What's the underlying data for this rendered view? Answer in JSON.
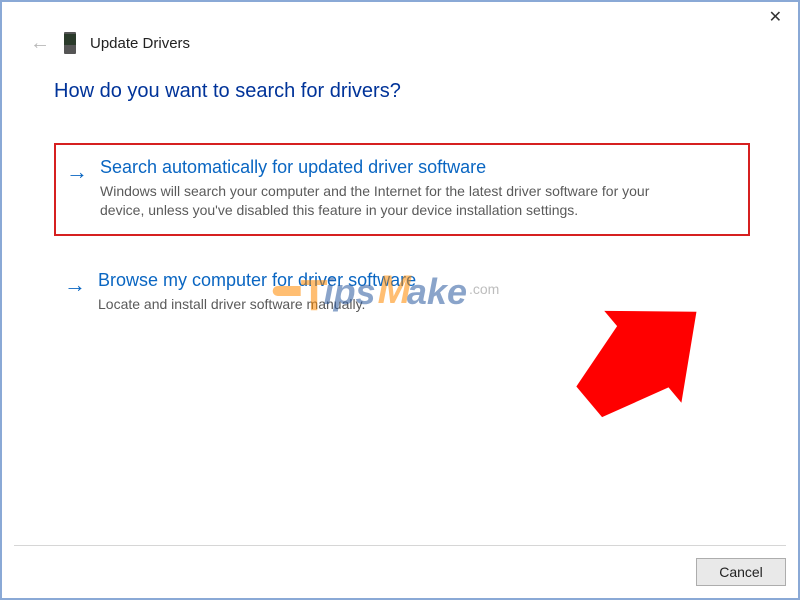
{
  "window": {
    "title": "Update Drivers"
  },
  "heading": "How do you want to search for drivers?",
  "options": [
    {
      "title": "Search automatically for updated driver software",
      "description": "Windows will search your computer and the Internet for the latest driver software for your device, unless you've disabled this feature in your device installation settings."
    },
    {
      "title": "Browse my computer for driver software",
      "description": "Locate and install driver software manually."
    }
  ],
  "buttons": {
    "cancel": "Cancel"
  },
  "watermark": {
    "part1": "T",
    "part2": "ips",
    "part3": "M",
    "part4": "ake",
    "suffix": ".com"
  },
  "annotation": {
    "highlight_color": "#d62020",
    "arrow_color": "#ff0000"
  }
}
